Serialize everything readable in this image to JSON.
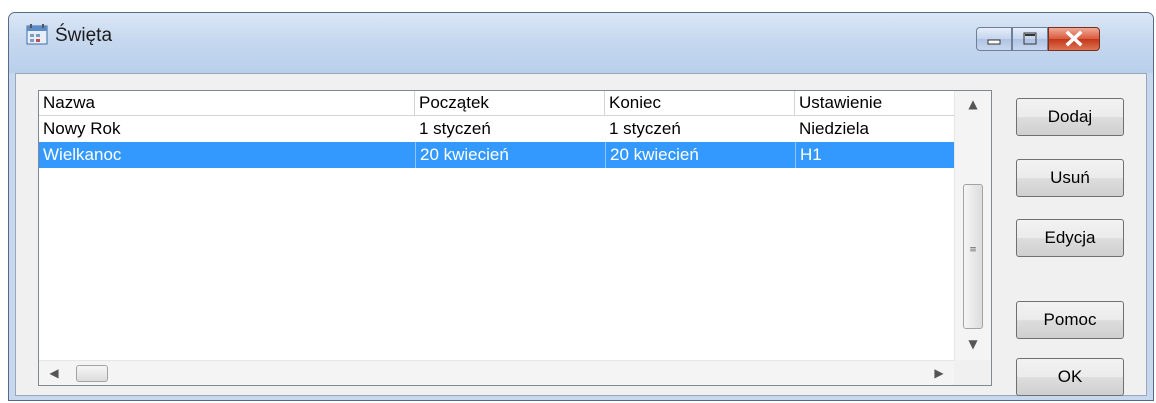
{
  "window": {
    "title": "Święta",
    "controls": {
      "minimize": "minimize-icon",
      "maximize": "maximize-icon",
      "close": "close-icon"
    }
  },
  "list": {
    "columns": [
      "Nazwa",
      "Początek",
      "Koniec",
      "Ustawienie"
    ],
    "rows": [
      {
        "nazwa": "Nowy Rok",
        "poczatek": "1 styczeń",
        "koniec": "1 styczeń",
        "ustawienie": "Niedziela",
        "selected": false
      },
      {
        "nazwa": "Wielkanoc",
        "poczatek": "20 kwiecień",
        "koniec": "20 kwiecień",
        "ustawienie": "H1",
        "selected": true
      }
    ]
  },
  "buttons": {
    "add": "Dodaj",
    "remove": "Usuń",
    "edit": "Edycja",
    "help": "Pomoc",
    "ok": "OK"
  },
  "colors": {
    "selection": "#3399ff",
    "titlebar": "#c6d8ef",
    "close": "#c4361a"
  }
}
